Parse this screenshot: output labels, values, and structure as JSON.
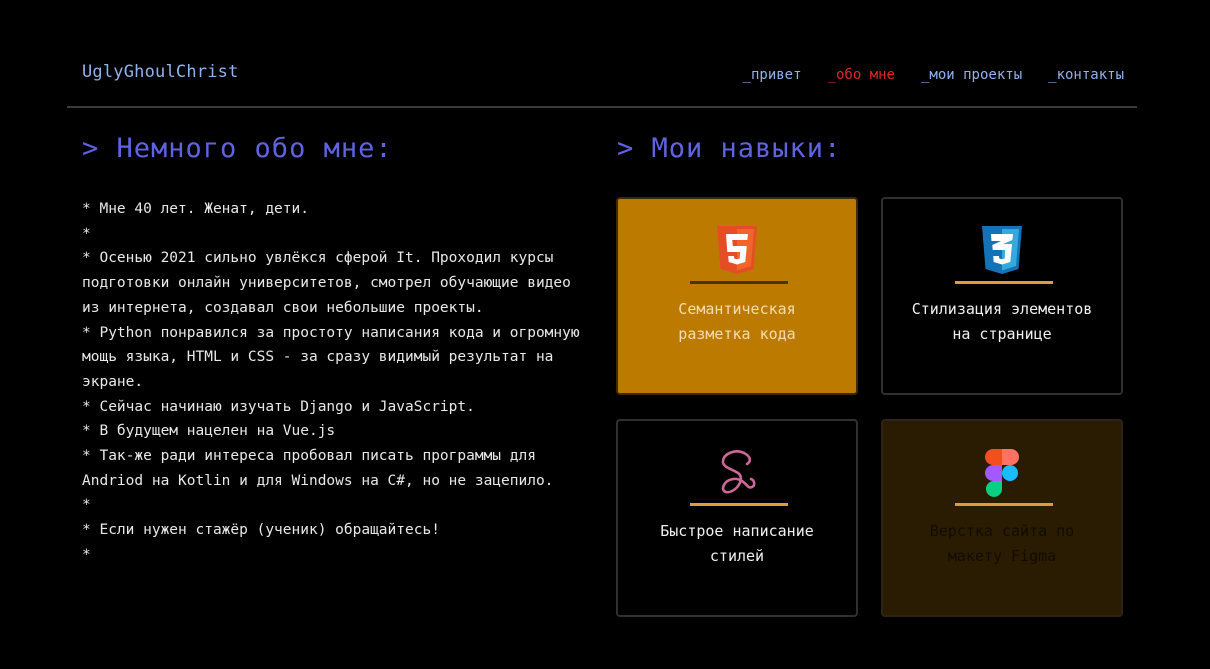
{
  "header": {
    "logo": "UglyGhoulChrist",
    "nav": [
      {
        "label": "_привет"
      },
      {
        "label": "_обо мне"
      },
      {
        "label": "_мои проекты"
      },
      {
        "label": "_контакты"
      }
    ],
    "active_nav": "_обо мне"
  },
  "about": {
    "title": "> Немного обо мне:",
    "lines": [
      "* Мне 40 лет. Женат, дети.",
      "*",
      "* Осенью 2021 сильно увлёкся сферой It. Проходил курсы подготовки онлайн университетов, смотрел обучающие видео из интернета, создавал свои небольшие проекты.",
      "* Python понравился за простоту написания кода и огромную мощь языка, HTML и CSS - за сразу видимый результат на экране.",
      "* Сейчас начинаю изучать Django и JavaScript.",
      "* В будущем нацелен на Vue.js",
      "* Так-же ради интереса пробовал писать программы для Andriod на Kotlin и для Windows на C#, но не зацепило.",
      "*",
      "* Если нужен стажёр (ученик) обращайтесь!",
      "*"
    ]
  },
  "skills": {
    "title": "> Мои навыки:",
    "cards": [
      {
        "icon": "html5-icon",
        "label": "Семантическая разметка кода"
      },
      {
        "icon": "css3-icon",
        "label": "Стилизация элементов на странице"
      },
      {
        "icon": "sass-icon",
        "label": "Быстрое написание стилей"
      },
      {
        "icon": "figma-icon",
        "label": "Верстка сайта по макету Figma"
      }
    ]
  },
  "colors": {
    "background": "#000000",
    "accent": "#5f63e0",
    "nav_link": "#8fb2ea",
    "nav_active": "#e0262b",
    "card_highlight": "#bd7a00",
    "rule": "#e39a3b"
  }
}
